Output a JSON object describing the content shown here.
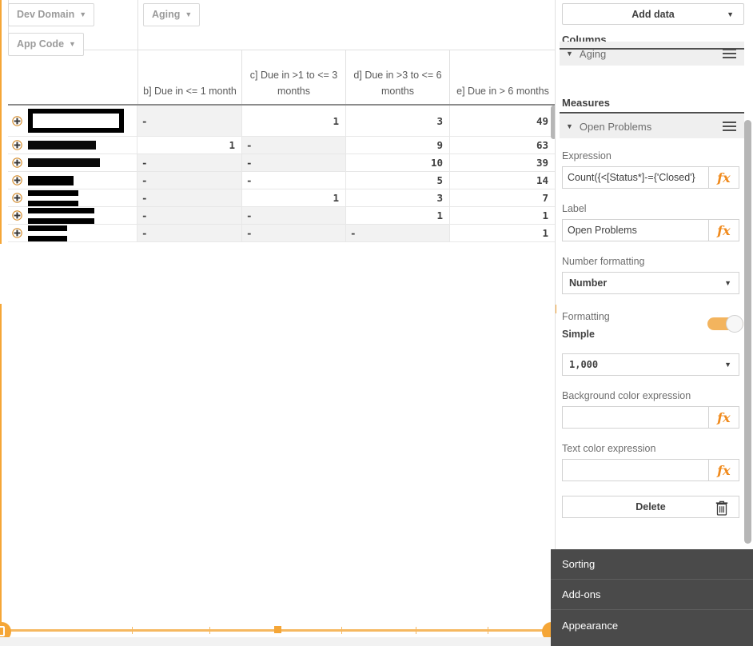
{
  "filters": {
    "items": [
      {
        "label": "Dev Domain",
        "icon": "chevron-down-icon"
      },
      {
        "label": "App Code",
        "icon": "chevron-down-icon"
      },
      {
        "label": "Aging",
        "icon": "chevron-down-icon"
      }
    ]
  },
  "chart_data": {
    "type": "table",
    "title": "",
    "categories": [
      "[redacted]",
      "[redacted]",
      "[redacted]",
      "[redacted]",
      "[redacted]",
      "[redacted]",
      "[redacted]"
    ],
    "columns": [
      "b] Due in <= 1 month",
      "c] Due in >1 to <= 3 months",
      "d] Due in >3 to <= 6 months",
      "e] Due in > 6 months"
    ],
    "rows": [
      {
        "label": "",
        "values": [
          "-",
          "1",
          "3",
          "49"
        ]
      },
      {
        "label": "",
        "values": [
          "1",
          "-",
          "9",
          "63"
        ]
      },
      {
        "label": "",
        "values": [
          "-",
          "-",
          "10",
          "39"
        ]
      },
      {
        "label": "",
        "values": [
          "-",
          "-",
          "5",
          "14"
        ]
      },
      {
        "label": "",
        "values": [
          "-",
          "1",
          "3",
          "7"
        ]
      },
      {
        "label": "",
        "values": [
          "-",
          "-",
          "1",
          "1"
        ]
      },
      {
        "label": "",
        "values": [
          "-",
          "-",
          "-",
          "1"
        ]
      }
    ],
    "measure": "Open Problems"
  },
  "panel": {
    "add_data_label": "Add data",
    "add_data_icon": "chevron-down-icon",
    "columns_title": "Columns",
    "columns_items": [
      {
        "label": "Aging"
      }
    ],
    "measures_title": "Measures",
    "measures_items": [
      {
        "label": "Open Problems"
      }
    ],
    "expression_label": "Expression",
    "expression_value": "Count({<[Status*]-={'Closed'}",
    "label_label": "Label",
    "label_value": "Open Problems",
    "number_formatting_label": "Number formatting",
    "number_formatting_value": "Number",
    "formatting_label": "Formatting",
    "formatting_mode": "Simple",
    "format_pattern_value": "1,000",
    "bg_color_label": "Background color expression",
    "bg_color_value": "",
    "text_color_label": "Text color expression",
    "text_color_value": "",
    "delete_label": "Delete",
    "delete_icon": "trash-icon",
    "fx_label": "fx"
  },
  "dark_menu": {
    "items": [
      {
        "label": "Sorting"
      },
      {
        "label": "Add-ons"
      },
      {
        "label": "Appearance"
      }
    ]
  },
  "colors": {
    "accent": "#f5a637",
    "fx_orange": "#f08a1c",
    "dark_panel": "#4a4a4a",
    "row_shade": "#f2f2f2"
  }
}
